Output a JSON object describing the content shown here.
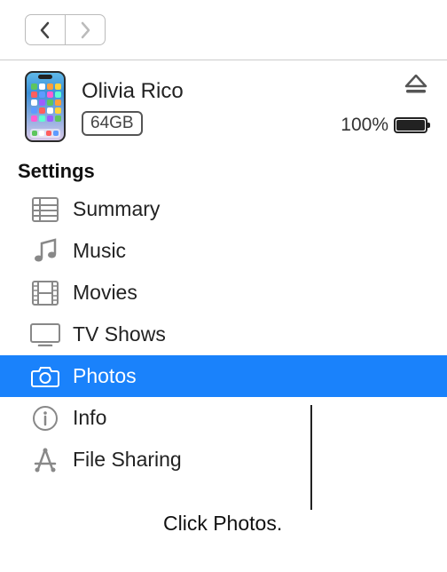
{
  "device": {
    "name": "Olivia Rico",
    "storage": "64GB",
    "battery_percent": "100%"
  },
  "section_title": "Settings",
  "menu": {
    "summary": "Summary",
    "music": "Music",
    "movies": "Movies",
    "tvshows": "TV Shows",
    "photos": "Photos",
    "info": "Info",
    "filesharing": "File Sharing"
  },
  "callout": "Click Photos."
}
